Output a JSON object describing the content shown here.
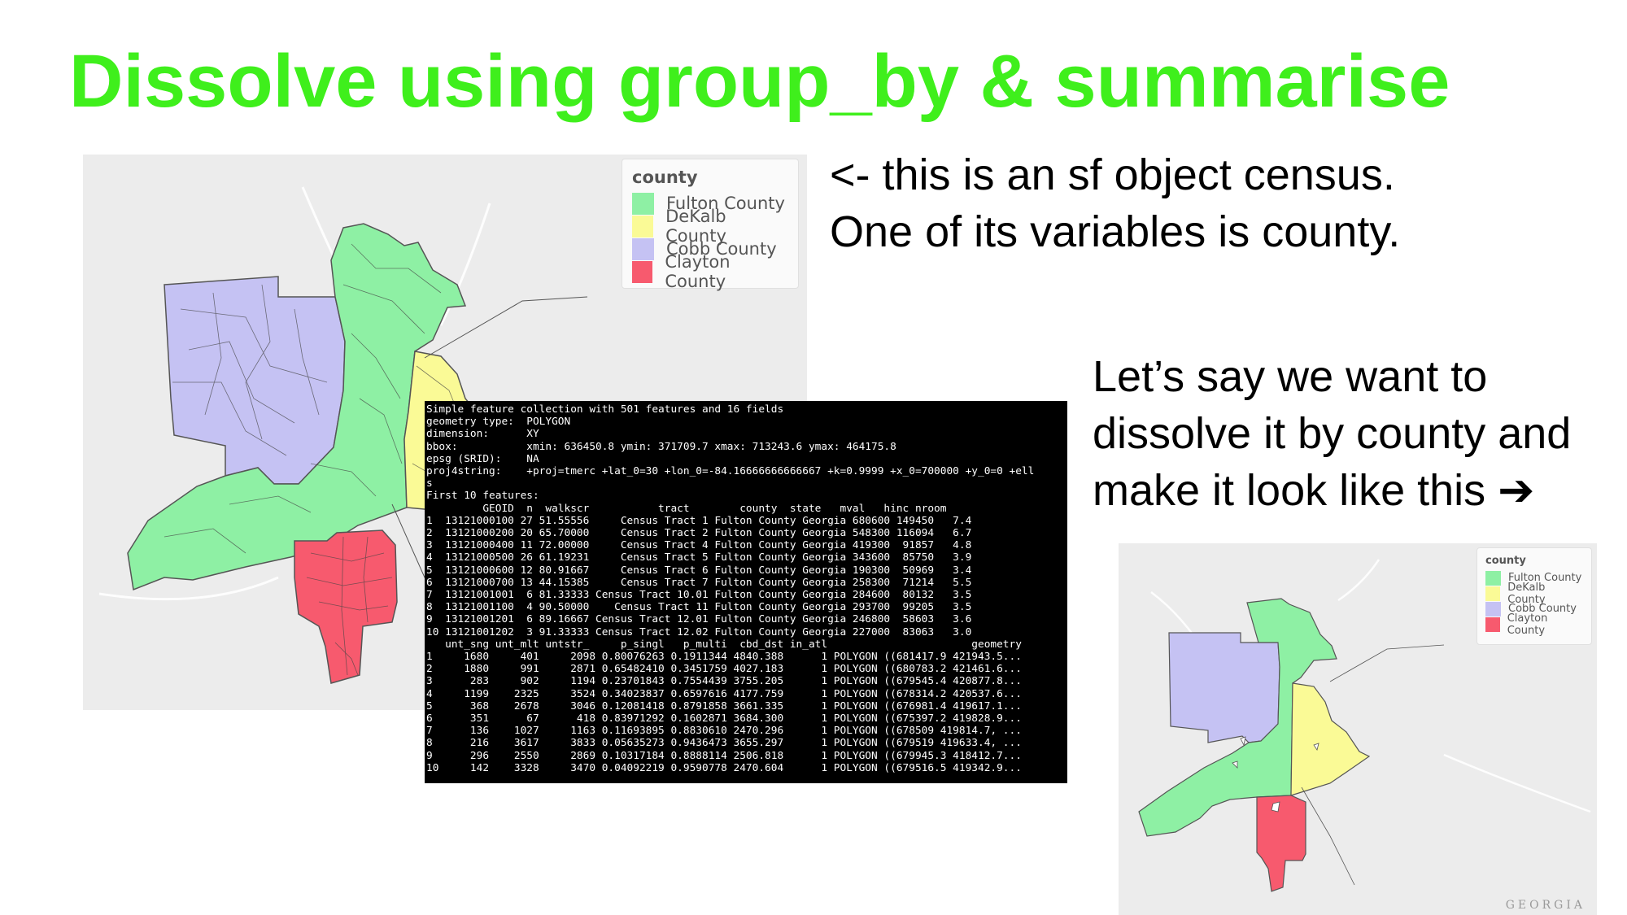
{
  "slide": {
    "title": "Dissolve using group_by & summarise",
    "note1": [
      "<- this is an sf object census.",
      "One of its variables is county."
    ],
    "note2": [
      "Let’s say we want to",
      "dissolve it by county and",
      "make it look like this ➔"
    ]
  },
  "legend": {
    "title": "county",
    "items": [
      {
        "label": "Fulton County",
        "color": "#8ef0a4"
      },
      {
        "label": "DeKalb County",
        "color": "#fafa96"
      },
      {
        "label": "Cobb County",
        "color": "#c5c2f3"
      },
      {
        "label": "Clayton County",
        "color": "#f75a6e"
      }
    ]
  },
  "map2_label": "GEORGIA",
  "console": {
    "lines": [
      "Simple feature collection with 501 features and 16 fields",
      "geometry type:  POLYGON",
      "dimension:      XY",
      "bbox:           xmin: 636450.8 ymin: 371709.7 xmax: 713243.6 ymax: 464175.8",
      "epsg (SRID):    NA",
      "proj4string:    +proj=tmerc +lat_0=30 +lon_0=-84.16666666666667 +k=0.9999 +x_0=700000 +y_0=0 +ell",
      "s",
      "First 10 features:",
      "         GEOID  n  walkscr           tract        county  state   mval   hinc nroom",
      "1  13121000100 27 51.55556     Census Tract 1 Fulton County Georgia 680600 149450   7.4",
      "2  13121000200 20 65.70000     Census Tract 2 Fulton County Georgia 548300 116094   6.7",
      "3  13121000400 11 72.00000     Census Tract 4 Fulton County Georgia 419300  91857   4.8",
      "4  13121000500 26 61.19231     Census Tract 5 Fulton County Georgia 343600  85750   3.9",
      "5  13121000600 12 80.91667     Census Tract 6 Fulton County Georgia 190300  50969   3.4",
      "6  13121000700 13 44.15385     Census Tract 7 Fulton County Georgia 258300  71214   5.5",
      "7  13121001001  6 81.33333 Census Tract 10.01 Fulton County Georgia 284600  80132   3.5",
      "8  13121001100  4 90.50000    Census Tract 11 Fulton County Georgia 293700  99205   3.5",
      "9  13121001201  6 89.16667 Census Tract 12.01 Fulton County Georgia 246800  58603   3.6",
      "10 13121001202  3 91.33333 Census Tract 12.02 Fulton County Georgia 227000  83063   3.0",
      "   unt_sng unt_mlt untstr_     p_singl   p_multi  cbd_dst in_atl                       geometry",
      "1     1680     401     2098 0.80076263 0.1911344 4840.388      1 POLYGON ((681417.9 421943.5...",
      "2     1880     991     2871 0.65482410 0.3451759 4027.183      1 POLYGON ((680783.2 421461.6...",
      "3      283     902     1194 0.23701843 0.7554439 3755.205      1 POLYGON ((679545.4 420877.8...",
      "4     1199    2325     3524 0.34023837 0.6597616 4177.759      1 POLYGON ((678314.2 420537.6...",
      "5      368    2678     3046 0.12081418 0.8791858 3661.335      1 POLYGON ((676981.4 419617.1...",
      "6      351      67      418 0.83971292 0.1602871 3684.300      1 POLYGON ((675397.2 419828.9...",
      "7      136    1027     1163 0.11693895 0.8830610 2470.296      1 POLYGON ((678509 419814.7, ...",
      "8      216    3617     3833 0.05635273 0.9436473 3655.297      1 POLYGON ((679519 419633.4, ...",
      "9      296    2550     2869 0.10317184 0.8888114 2506.818      1 POLYGON ((679945.3 418412.7...",
      "10     142    3328     3470 0.04092219 0.9590778 2470.604      1 POLYGON ((679516.5 419342.9..."
    ]
  }
}
